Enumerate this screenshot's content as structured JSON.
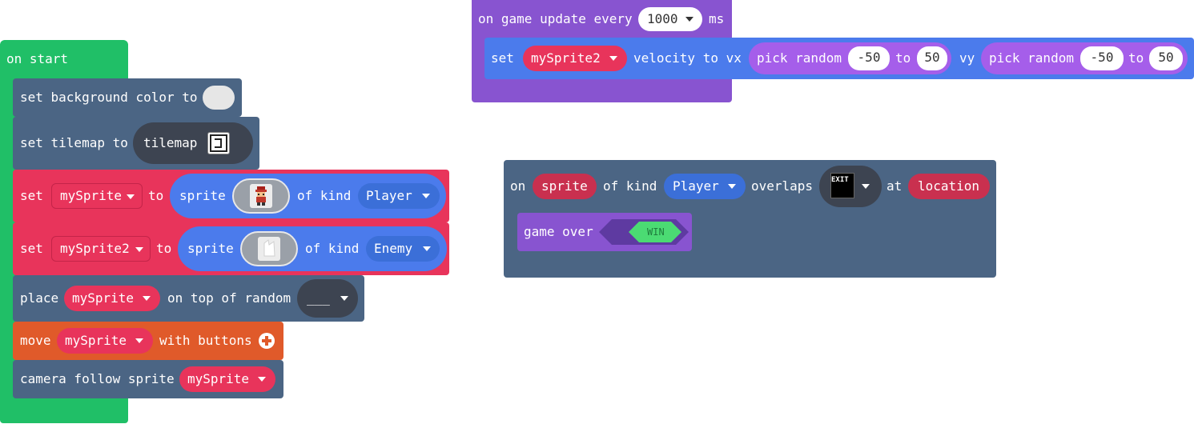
{
  "colors": {
    "green": "#20bf67",
    "slate": "#4b6584",
    "red": "#e8345b",
    "blue": "#4b7bec",
    "purple": "#8854d0",
    "orange": "#e05a2a",
    "dark_gray": "#3d4451"
  },
  "on_start": {
    "hat": "on start",
    "set_bg": {
      "label": "set background color to"
    },
    "set_tilemap": {
      "label": "set tilemap to",
      "value": "tilemap"
    },
    "set_sprite1": {
      "set": "set",
      "var": "mySprite",
      "to": "to",
      "sprite": "sprite",
      "of_kind": "of kind",
      "kind": "Player"
    },
    "set_sprite2": {
      "set": "set",
      "var": "mySprite2",
      "to": "to",
      "sprite": "sprite",
      "of_kind": "of kind",
      "kind": "Enemy"
    },
    "place": {
      "place": "place",
      "var": "mySprite",
      "on_top": "on top of random",
      "tile": "___"
    },
    "move": {
      "move": "move",
      "var": "mySprite",
      "with_buttons": "with buttons"
    },
    "camera": {
      "label": "camera follow sprite",
      "var": "mySprite"
    }
  },
  "game_update": {
    "hat": "on game update every",
    "interval": "1000",
    "unit": "ms",
    "set": "set",
    "var": "mySprite2",
    "velocity": "velocity to vx",
    "pick1": "pick random",
    "min1": "-50",
    "to1": "to",
    "max1": "50",
    "vy": "vy",
    "pick2": "pick random",
    "min2": "-50",
    "to2": "to",
    "max2": "50"
  },
  "overlap": {
    "on": "on",
    "sprite": "sprite",
    "of_kind": "of kind",
    "kind": "Player",
    "overlaps": "overlaps",
    "tile_text": "EXIT",
    "at": "at",
    "location": "location",
    "game_over": "game over",
    "win": "WIN"
  }
}
